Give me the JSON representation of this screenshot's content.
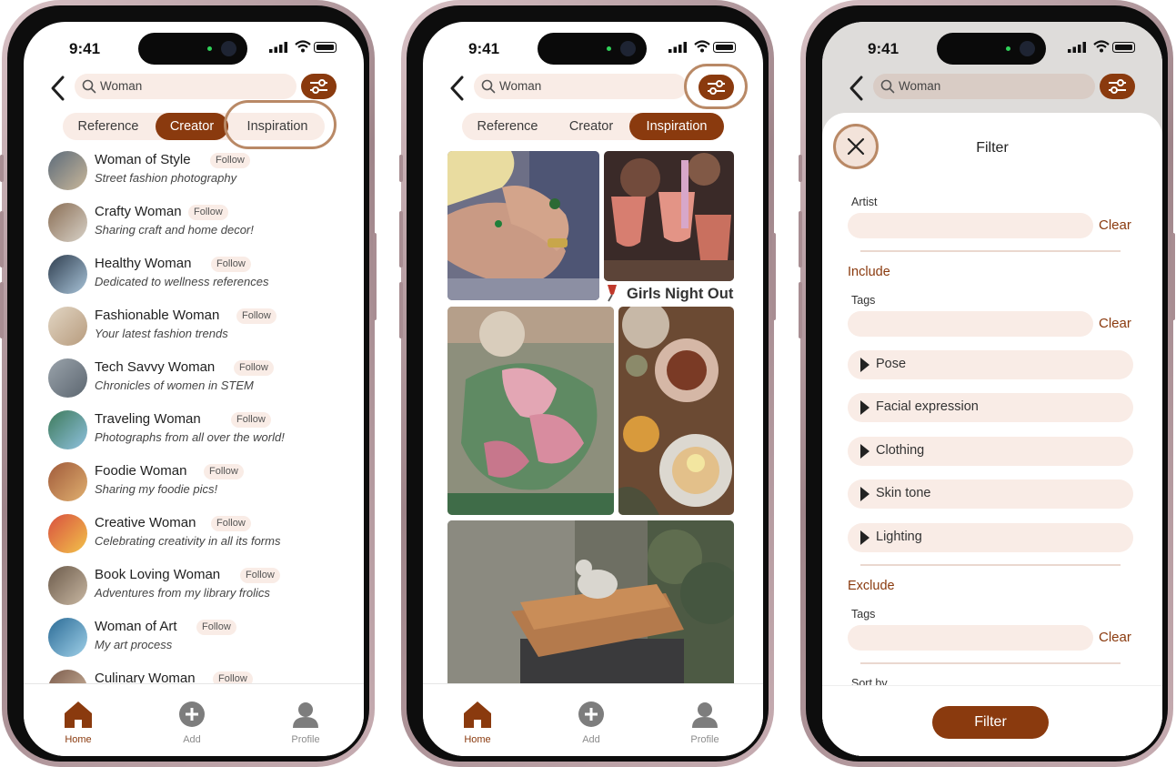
{
  "status": {
    "time": "9:41"
  },
  "search": {
    "value": "Woman"
  },
  "tabs": [
    "Reference",
    "Creator",
    "Inspiration"
  ],
  "creators": [
    {
      "name": "Woman of Style",
      "desc": "Street fashion photography",
      "follow": "Follow"
    },
    {
      "name": "Crafty Woman",
      "desc": "Sharing craft and home decor!",
      "follow": "Follow"
    },
    {
      "name": "Healthy Woman",
      "desc": "Dedicated to wellness references",
      "follow": "Follow"
    },
    {
      "name": "Fashionable Woman",
      "desc": "Your latest fashion trends",
      "follow": "Follow"
    },
    {
      "name": "Tech Savvy Woman",
      "desc": "Chronicles of women in STEM",
      "follow": "Follow"
    },
    {
      "name": "Traveling Woman",
      "desc": "Photographs from all over the world!",
      "follow": "Follow"
    },
    {
      "name": "Foodie Woman",
      "desc": "Sharing my foodie pics!",
      "follow": "Follow"
    },
    {
      "name": "Creative Woman",
      "desc": "Celebrating creativity in all its forms",
      "follow": "Follow"
    },
    {
      "name": "Book Loving Woman",
      "desc": "Adventures from my library frolics",
      "follow": "Follow"
    },
    {
      "name": "Woman of Art",
      "desc": "My art process",
      "follow": "Follow"
    },
    {
      "name": "Culinary Woman",
      "desc": "",
      "follow": "Follow"
    }
  ],
  "nav": {
    "home": "Home",
    "add": "Add",
    "profile": "Profile"
  },
  "inspiration": {
    "caption": "Girls Night Out"
  },
  "filter": {
    "title": "Filter",
    "artist_label": "Artist",
    "clear": "Clear",
    "include": "Include",
    "tags_label": "Tags",
    "categories": [
      "Pose",
      "Facial expression",
      "Clothing",
      "Skin tone",
      "Lighting"
    ],
    "exclude": "Exclude",
    "sort_by": "Sort by",
    "apply": "Filter"
  },
  "colors": {
    "accent": "#8a3a0e",
    "pill": "#f9ece6",
    "highlight_ring": "#b98966"
  }
}
